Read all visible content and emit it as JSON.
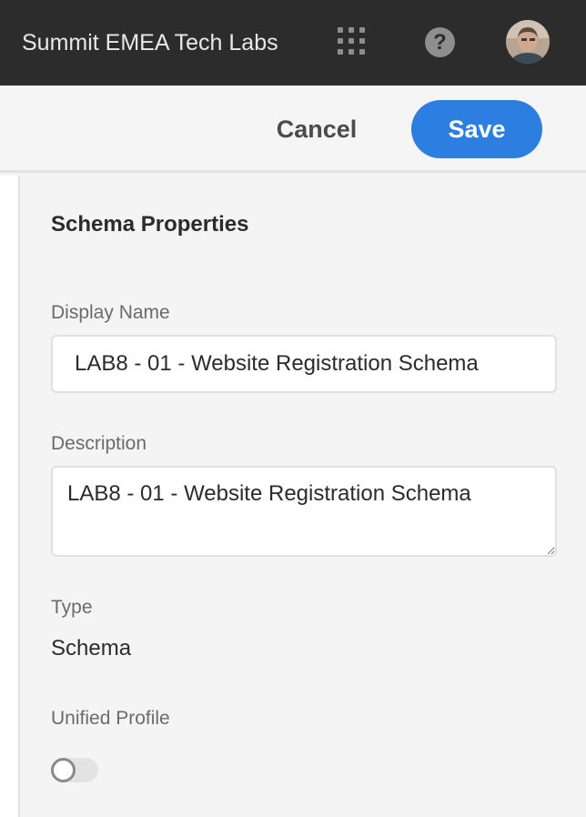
{
  "header": {
    "org_name": "Summit EMEA Tech Labs",
    "icons": [
      "apps-grid-icon",
      "help-icon",
      "user-avatar"
    ],
    "help_glyph": "?"
  },
  "actions": {
    "cancel_label": "Cancel",
    "save_label": "Save",
    "save_color": "#2d7ee1"
  },
  "panel": {
    "title": "Schema Properties",
    "display_name": {
      "label": "Display Name",
      "value": "LAB8 - 01 - Website Registration Schema"
    },
    "description": {
      "label": "Description",
      "value": "LAB8 - 01 - Website Registration Schema"
    },
    "type": {
      "label": "Type",
      "value": "Schema"
    },
    "unified_profile": {
      "label": "Unified Profile",
      "enabled": false
    }
  }
}
